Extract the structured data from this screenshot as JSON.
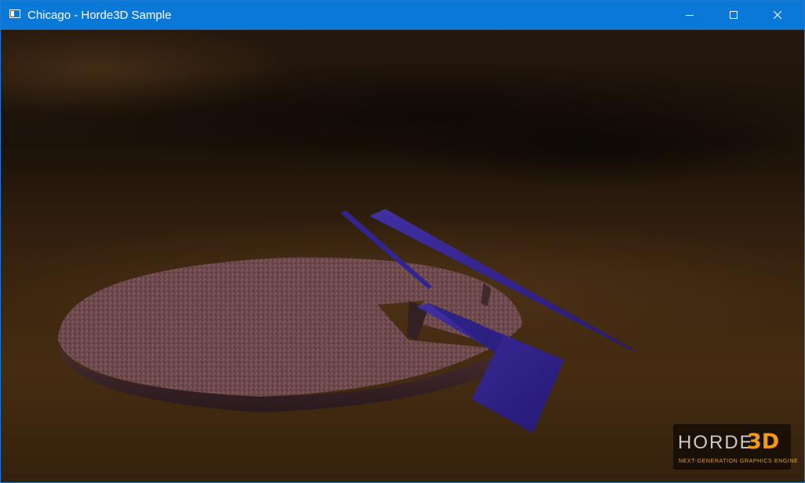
{
  "window": {
    "title": "Chicago - Horde3D Sample",
    "titlebar_color": "#0a78d7",
    "app_icon": "window-icon",
    "controls": {
      "minimize_icon": "minimize-icon",
      "maximize_icon": "maximize-icon",
      "close_icon": "close-icon"
    }
  },
  "scene": {
    "background_color": "#2a1a0c",
    "platform_color": "#7a5055",
    "blade_color": "#3b2aa0"
  },
  "logo": {
    "word": "HORDE",
    "mark": "3D",
    "tagline": "NEXT-GENERATION GRAPHICS ENGINE",
    "accent_color": "#f39a12"
  }
}
